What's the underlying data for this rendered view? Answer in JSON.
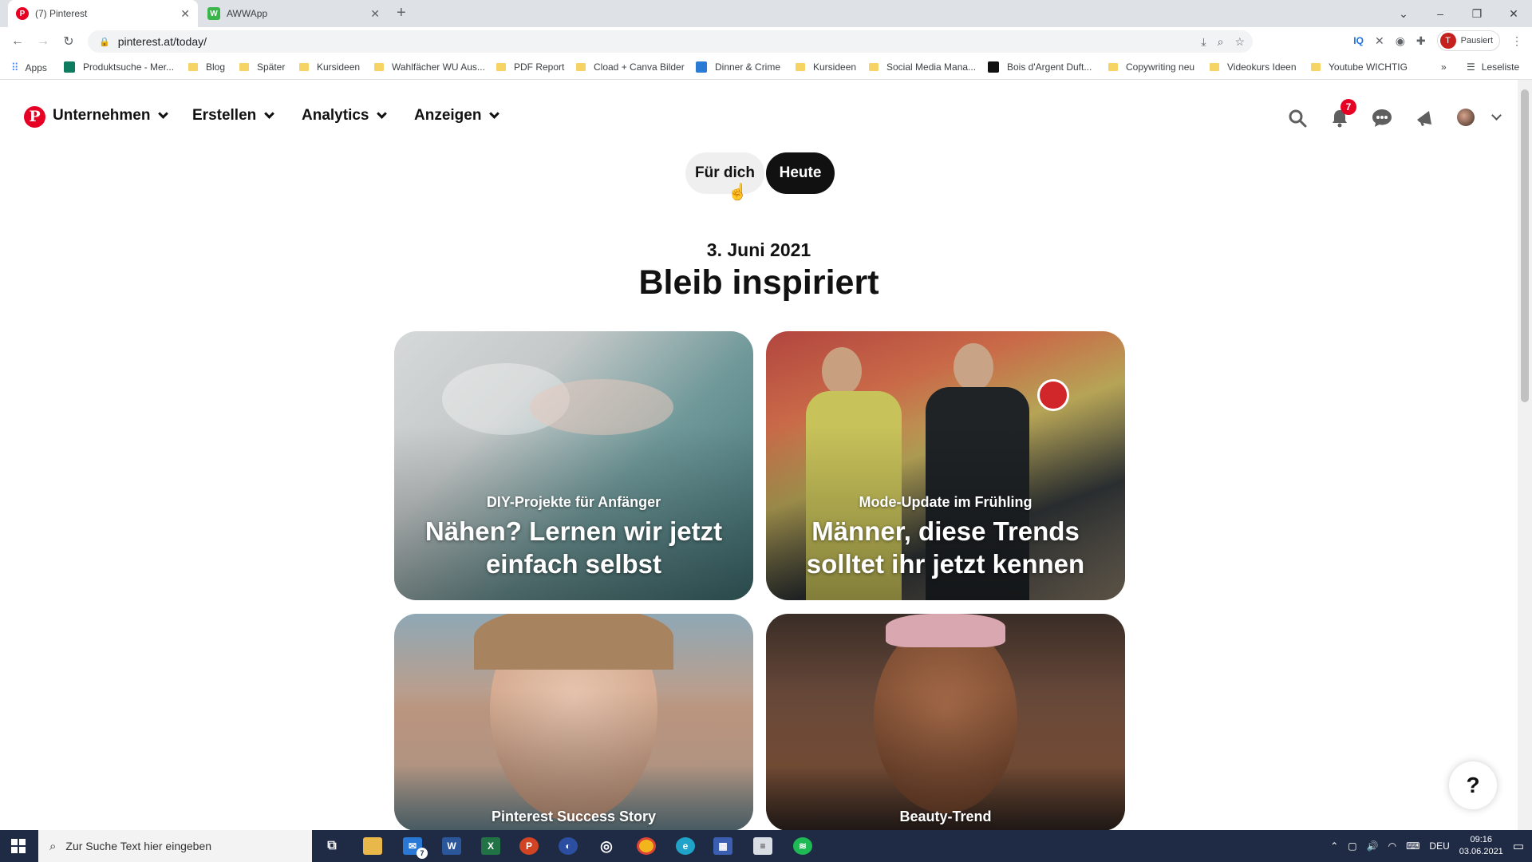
{
  "browser": {
    "tabs": [
      {
        "title": "(7) Pinterest",
        "active": true
      },
      {
        "title": "AWWApp",
        "active": false
      }
    ],
    "url": "pinterest.at/today/",
    "profile_status": "Pausiert",
    "profile_initial": "T",
    "bookmarks": [
      "Apps",
      "Produktsuche - Mer...",
      "Blog",
      "Später",
      "Kursideen",
      "Wahlfächer WU Aus...",
      "PDF Report",
      "Cload + Canva Bilder",
      "Dinner & Crime",
      "Kursideen",
      "Social Media Mana...",
      "Bois d'Argent Duft...",
      "Copywriting neu",
      "Videokurs Ideen",
      "Youtube WICHTIG"
    ],
    "reading_list": "Leseliste"
  },
  "header": {
    "logo": "P",
    "menu": [
      "Unternehmen",
      "Erstellen",
      "Analytics",
      "Anzeigen"
    ],
    "notification_count": "7"
  },
  "toggle": {
    "for_you": "Für dich",
    "today": "Heute"
  },
  "today": {
    "date": "3. Juni 2021",
    "title": "Bleib inspiriert"
  },
  "cards": [
    {
      "subtitle": "DIY-Projekte für Anfänger",
      "headline": "Nähen? Lernen wir jetzt einfach selbst"
    },
    {
      "subtitle": "Mode-Update im Frühling",
      "headline": "Männer, diese Trends solltet ihr jetzt kennen"
    },
    {
      "subtitle": "Pinterest Success Story"
    },
    {
      "subtitle": "Beauty-Trend"
    }
  ],
  "help": "?",
  "taskbar": {
    "search_placeholder": "Zur Suche Text hier eingeben",
    "language": "DEU",
    "time": "09:16",
    "date": "03.06.2021",
    "mail_badge": "7"
  }
}
